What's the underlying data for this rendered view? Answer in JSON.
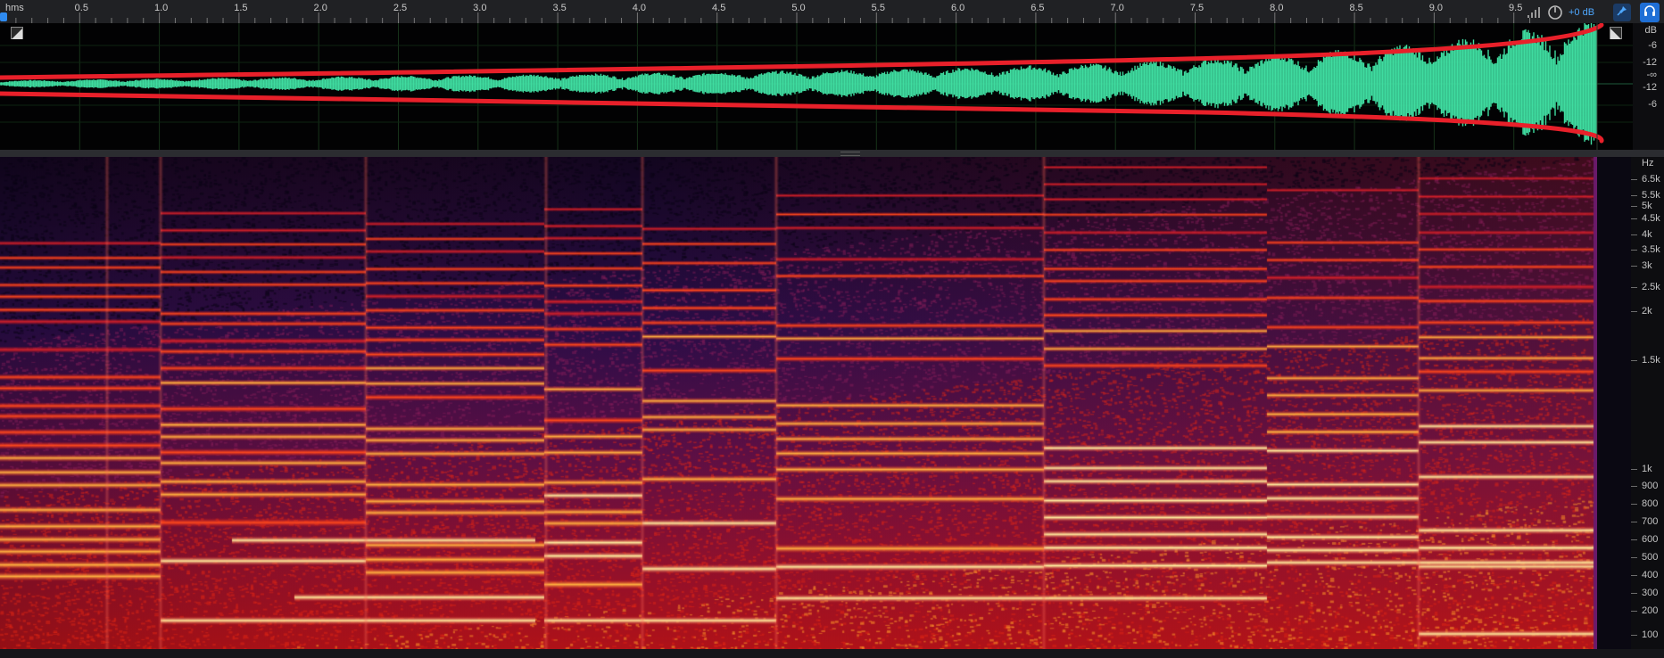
{
  "ruler": {
    "unit": "hms",
    "ticks": [
      "0.5",
      "1.0",
      "1.5",
      "2.0",
      "2.5",
      "3.0",
      "3.5",
      "4.0",
      "4.5",
      "5.0",
      "5.5",
      "6.0",
      "6.5",
      "7.0",
      "7.5",
      "8.0",
      "8.5",
      "9.0",
      "9.5"
    ]
  },
  "toolbar": {
    "gain_label": "+0 dB",
    "icons": [
      "meter-icon",
      "knob-icon",
      "pin-icon",
      "headphones-icon"
    ]
  },
  "waveform": {
    "scale_labels": [
      "dB",
      "-6",
      "-12",
      "-∞",
      "-12",
      "-6"
    ],
    "color": "#3fdca0",
    "envelope_color": "#e8202a",
    "background": "#020203"
  },
  "spectrogram": {
    "scale_labels": [
      "Hz",
      "6.5k",
      "5.5k",
      "5k",
      "4.5k",
      "4k",
      "3.5k",
      "3k",
      "2.5k",
      "2k",
      "1.5k",
      "1k",
      "900",
      "800",
      "700",
      "600",
      "500",
      "400",
      "300",
      "200",
      "100"
    ],
    "colors": {
      "low": "#1b0a2c",
      "mid": "#b8121a",
      "high": "#ffe98a"
    }
  }
}
